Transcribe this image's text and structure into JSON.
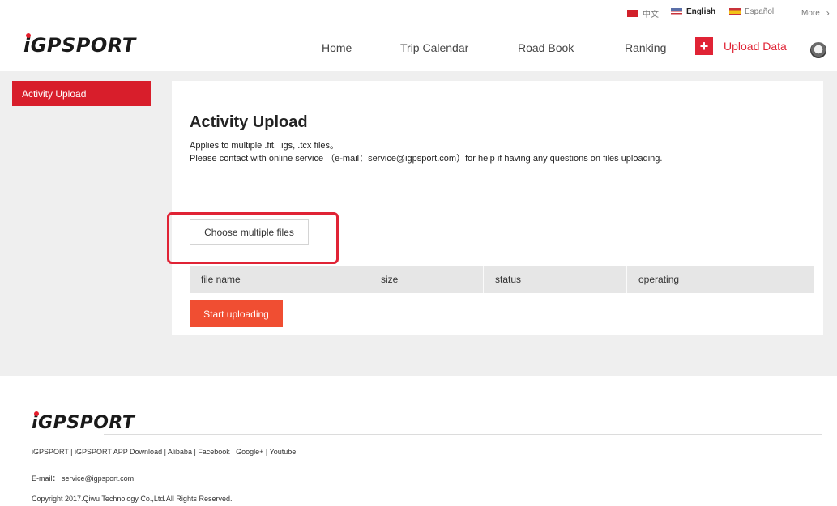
{
  "languages": {
    "chinese": "中文",
    "english": "English",
    "spanish": "Español",
    "more": "More"
  },
  "header": {
    "logo": "iGPSPORT",
    "nav": [
      "Home",
      "Trip Calendar",
      "Road Book",
      "Ranking"
    ],
    "upload_plus": "+",
    "upload_label": "Upload Data"
  },
  "sidebar": {
    "items": [
      {
        "label": "Activity Upload",
        "active": true
      }
    ]
  },
  "main": {
    "title": "Activity Upload",
    "desc_line1": "Applies to multiple .fit, .igs, .tcx files。",
    "desc_line2": "Please contact with online service （e-mail：service@igpsport.com）for help if having any questions on files uploading.",
    "choose_label": "Choose multiple files",
    "table_headers": [
      "file name",
      "size",
      "status",
      "operating"
    ],
    "start_label": "Start uploading"
  },
  "footer": {
    "logo": "iGPSPORT",
    "links": "iGPSPORT | iGPSPORT APP Download | Alibaba | Facebook | Google+ | Youtube",
    "email": "E-mail： service@igpsport.com",
    "copyright": "Copyright 2017.Qiwu Technology Co.,Ltd.All Rights Reserved."
  },
  "colors": {
    "accent": "#e02335",
    "start_button": "#f04e32",
    "background": "#efefef"
  },
  "icons": {
    "china-flag": "flag",
    "us-flag": "flag",
    "spain-flag": "flag",
    "more": "chevron-right-icon",
    "upload": "plus-icon",
    "user": "avatar"
  }
}
